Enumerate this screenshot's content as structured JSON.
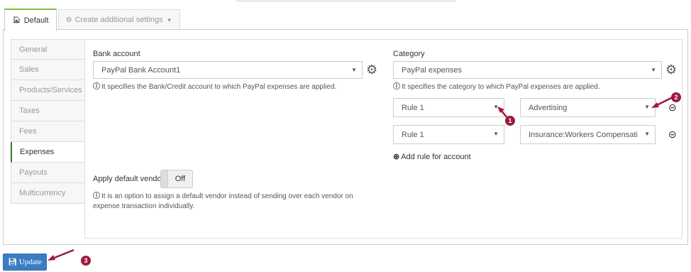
{
  "tabs": {
    "default_label": "Default",
    "default_icon": "home-icon",
    "additional_label": "Create additional settings",
    "additional_icon": "gear-icon"
  },
  "sidebar": {
    "items": [
      {
        "label": "General"
      },
      {
        "label": "Sales"
      },
      {
        "label": "Products/Services"
      },
      {
        "label": "Taxes"
      },
      {
        "label": "Fees"
      },
      {
        "label": "Expenses",
        "active": true
      },
      {
        "label": "Payouts"
      },
      {
        "label": "Multicurrency"
      }
    ]
  },
  "bank": {
    "label": "Bank account",
    "value": "PayPal Bank Account1",
    "help": "It specifies the Bank/Credit account to which PayPal expenses are applied."
  },
  "category": {
    "label": "Category",
    "value": "PayPal expenses",
    "help": "It specifies the category to which PayPal expenses are applied."
  },
  "rules": [
    {
      "rule": "Rule 1",
      "account": "Advertising"
    },
    {
      "rule": "Rule 1",
      "account": "Insurance:Workers Compensati"
    }
  ],
  "add_rule_label": "Add rule for account",
  "vendor": {
    "label": "Apply default vendor",
    "toggle_label": "Off",
    "help_line1": "It is an option to assign a default vendor instead of sending over each vendor on",
    "help_line2": "expense transaction individually."
  },
  "update_label": "Update",
  "badges": [
    "1",
    "2",
    "3"
  ],
  "colors": {
    "accent": "#3b7dc4",
    "annotation": "#9c1a3c",
    "active_tab": "#7fbf3f",
    "active_nav": "#2e7d32"
  }
}
